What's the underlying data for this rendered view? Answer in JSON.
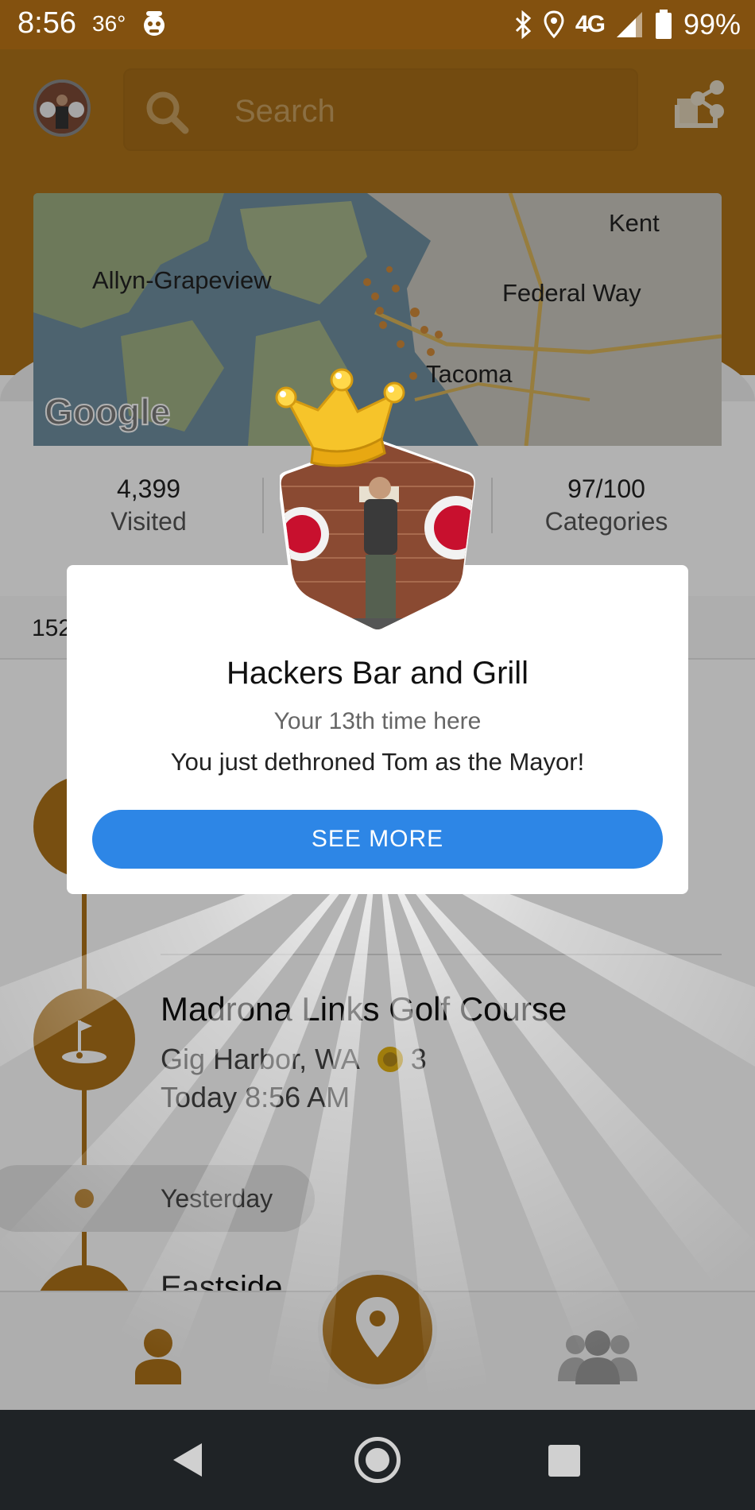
{
  "status_bar": {
    "time": "8:56",
    "temperature": "36°",
    "network": "4G",
    "battery": "99%",
    "icons": [
      "weather-icon",
      "bluetooth-icon",
      "location-icon",
      "signal-icon",
      "battery-icon"
    ]
  },
  "header": {
    "search": {
      "placeholder": "Search"
    },
    "icons": {
      "search": "search-icon",
      "share": "share-icon",
      "avatar": "avatar"
    }
  },
  "map": {
    "labels": {
      "kent": "Kent",
      "allyn": "Allyn-Grapeview",
      "federal_way": "Federal Way",
      "tacoma": "Tacoma"
    },
    "attribution": "Google"
  },
  "stats": {
    "visited_count": "4,399",
    "visited_label": "Visited",
    "categories_count": "97/100",
    "categories_label": "Categories"
  },
  "list": {
    "count_partial": "152",
    "checkins": [
      {
        "name": "Madrona Links Golf Course",
        "location": "Gig Harbor, WA",
        "coins": "3",
        "time": "Today 8:56 AM",
        "icon": "golf-flag-icon"
      },
      {
        "name": "Eastside"
      }
    ],
    "section_label": "Yesterday"
  },
  "bottom_nav": {
    "items": [
      "profile-icon",
      "checkin-pin-icon",
      "friends-icon"
    ]
  },
  "modal": {
    "title": "Hackers Bar and Grill",
    "subtitle": "Your 13th time here",
    "message": "You just dethroned Tom as the Mayor!",
    "button": "SEE MORE",
    "icons": {
      "crown": "crown-icon"
    }
  },
  "colors": {
    "header_orange": "#ad7219",
    "status_bar": "#83510f",
    "button_blue": "#2d86e6",
    "coin_gold": "#e6b312"
  }
}
